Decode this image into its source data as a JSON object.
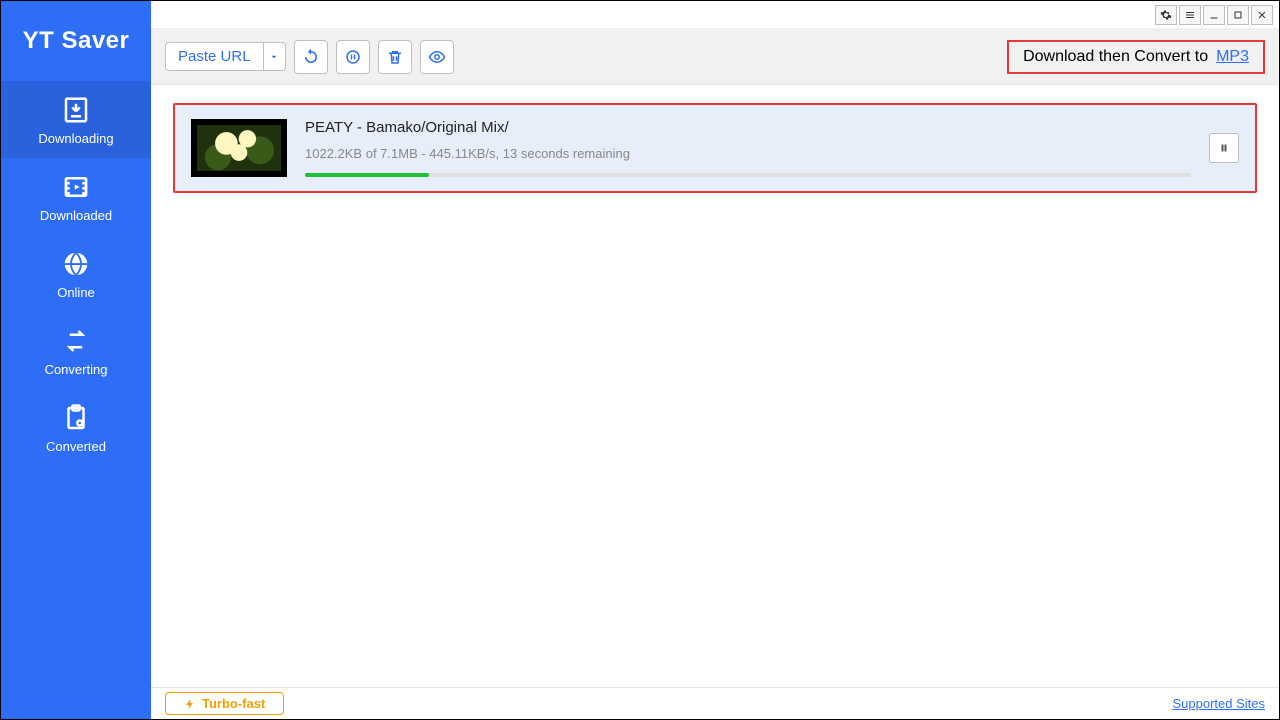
{
  "brand": "YT Saver",
  "sidebar": {
    "items": [
      {
        "label": "Downloading",
        "active": true
      },
      {
        "label": "Downloaded"
      },
      {
        "label": "Online"
      },
      {
        "label": "Converting"
      },
      {
        "label": "Converted"
      }
    ]
  },
  "toolbar": {
    "paste_url_label": "Paste URL",
    "convert_label": "Download then Convert to",
    "convert_format": "MP3"
  },
  "download": {
    "title": "PEATY - Bamako/Original Mix/",
    "status": "1022.2KB of 7.1MB -  445.11KB/s, 13 seconds remaining",
    "progress_percent": 14
  },
  "footer": {
    "turbo_label": "Turbo-fast",
    "supported_sites_label": "Supported Sites"
  }
}
